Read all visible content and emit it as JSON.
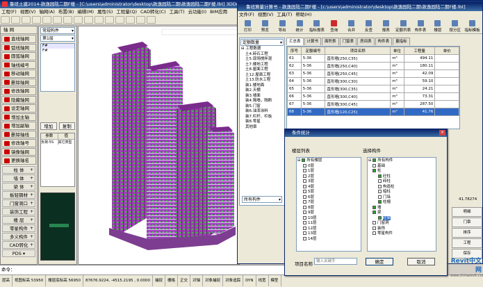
{
  "cad": {
    "title": "鲁班土建2014-款逸园陆二期F楼 - [C:\\users\\administrator\\desktop\\款逸园陆二期\\款逸园陆二期F楼.lbt] 3DDrawMode",
    "menus": [
      "工程(F)",
      "视图(V)",
      "轴网(A)",
      "布置(B)",
      "编辑(M)",
      "属性(S)",
      "工程量(Q)",
      "CAD转化(C)",
      "工具(T)",
      "云功能(I)",
      "BIM应用"
    ],
    "axis_tab": "轴 网",
    "axis_items": [
      "直线轴网",
      "弧线轴网",
      "圆弧轴网",
      "轴线编号",
      "移动轴网",
      "删除轴网",
      "修改轴网",
      "隐藏轴网",
      "设定轴网",
      "增加主轴",
      "增加副轴",
      "删除轴线",
      "修改轴号",
      "镜像轴网",
      "更换轴名"
    ],
    "nav_items": [
      "柱 体",
      "墙 体",
      "梁 体",
      "板轻钢材",
      "门窗洞口",
      "装饰工程",
      "楼 层",
      "零星构件",
      "多义构件",
      "CAD转化"
    ],
    "nav_bottom": "PDS ▾",
    "prop_select_1": "常规构件",
    "prop_select_2": "第1层",
    "list_items": [
      "F#",
      "F#"
    ],
    "btn_add": "增加",
    "btn_copy": "复制",
    "param_headers": [
      "参数",
      "值"
    ],
    "param_row": [
      "负荷-5S",
      "其它类型"
    ],
    "command_label": "命令：",
    "status_items": [
      "层高",
      "视图标高 53950",
      "楼层底标高 56950",
      "87676.9224,  -4515.2195 ,   0.0000",
      "捕捉",
      "栅格",
      "正交",
      "对轴",
      "对象捕捉",
      "对象追踪",
      "DYN",
      "线宽",
      "模型"
    ]
  },
  "calc": {
    "title": "鲁班算量计算书 - 款逸园陆二期F楼 - [c:\\users\\administrator\\desktop\\款逸园陆二期\\款逸园陆二期F楼.lbt]",
    "menus": [
      "文件(F)",
      "视图(V)",
      "工具(T)",
      "帮助(H)"
    ],
    "toolbar": [
      "打印",
      "预览",
      "导出",
      "统计",
      "指标报表",
      "查询",
      "合并",
      "反查",
      "报表",
      "定额列表",
      "构件表",
      "楼层",
      "按分区",
      "指标模板"
    ],
    "tree_select": "定额数量",
    "tree_root": "工程数据",
    "tree_items": [
      "土4.砖石工程",
      "土5.现场搅拌混",
      "土7.楼地工程",
      "土8.屋面工程",
      "土12.屋面工程",
      "土13.防水工程",
      "装1.楼地面",
      "装2.天棚",
      "装3.墙面",
      "装4.隔墙，隔断",
      "装5.门窗",
      "装6.油漆涂料",
      "装7.栏杆、栏板",
      "装8.零星",
      "其他章"
    ],
    "tree_bottom": "所有构件",
    "tabs": [
      "汇总表",
      "计算书",
      "面积表",
      "门窗表",
      "房间表",
      "构件表",
      "量指标"
    ],
    "table_headers": [
      "序号",
      "定额编号",
      "项目名称",
      "单位",
      "工程量",
      "单价"
    ],
    "rows": [
      [
        "61",
        "5-36",
        "直形墙[250,C35]",
        "m³",
        "494.11",
        ""
      ],
      [
        "62",
        "5-36",
        "直形墙[250,C40]",
        "m³",
        "180.11",
        ""
      ],
      [
        "63",
        "5-36",
        "直形墙[250,C45]",
        "m³",
        "42.09",
        ""
      ],
      [
        "64",
        "5-36",
        "直形墙[300,C30]",
        "m³",
        "59.10",
        ""
      ],
      [
        "65",
        "5-36",
        "直形墙[300,C35]",
        "m³",
        "24.21",
        ""
      ],
      [
        "66",
        "5-36",
        "直形墙[300,C40]",
        "m³",
        "73.31",
        ""
      ],
      [
        "67",
        "5-36",
        "直形墙[300,C45]",
        "m³",
        "287.50",
        ""
      ],
      [
        "68",
        "5-36",
        "直形墙[120,C25]",
        "m³",
        "41.76",
        ""
      ]
    ],
    "side_total": "41.78274",
    "side_labels": [
      "明细",
      "门章",
      "排序",
      "工程",
      "保存"
    ]
  },
  "dialog": {
    "title": "条件统计",
    "floor_label": "楼层列表",
    "comp_label": "选择构件",
    "floor_root": "所有楼层",
    "floors": [
      "0层",
      "1层",
      "2层",
      "3层",
      "4层",
      "5层",
      "6层",
      "7层",
      "8层",
      "9层",
      "10层",
      "11层",
      "12层",
      "13层",
      "14层"
    ],
    "comp_root": "所有构件",
    "comps": [
      "基础",
      "柱",
      "砼柱",
      "砖柱",
      "构造柱",
      "暗柱",
      "门垛",
      "柱帽",
      "墙",
      "梁",
      "砼梁",
      "门窗洞",
      "装饰",
      "零星构件"
    ],
    "name_label": "项目名称",
    "name_placeholder": "输入关键字",
    "ok": "确定",
    "cancel": "取消"
  },
  "watermark": {
    "brand": "Revit中文网",
    "url": "www.chinarevit.com"
  },
  "colors": {
    "titlebar": "#0a246a",
    "selected_row": "#316ac5",
    "building_purple": "#9b3fb3",
    "building_green": "#3fb83f",
    "viewport_bg": "#ffffff",
    "preview_bg": "#0b2f20"
  }
}
